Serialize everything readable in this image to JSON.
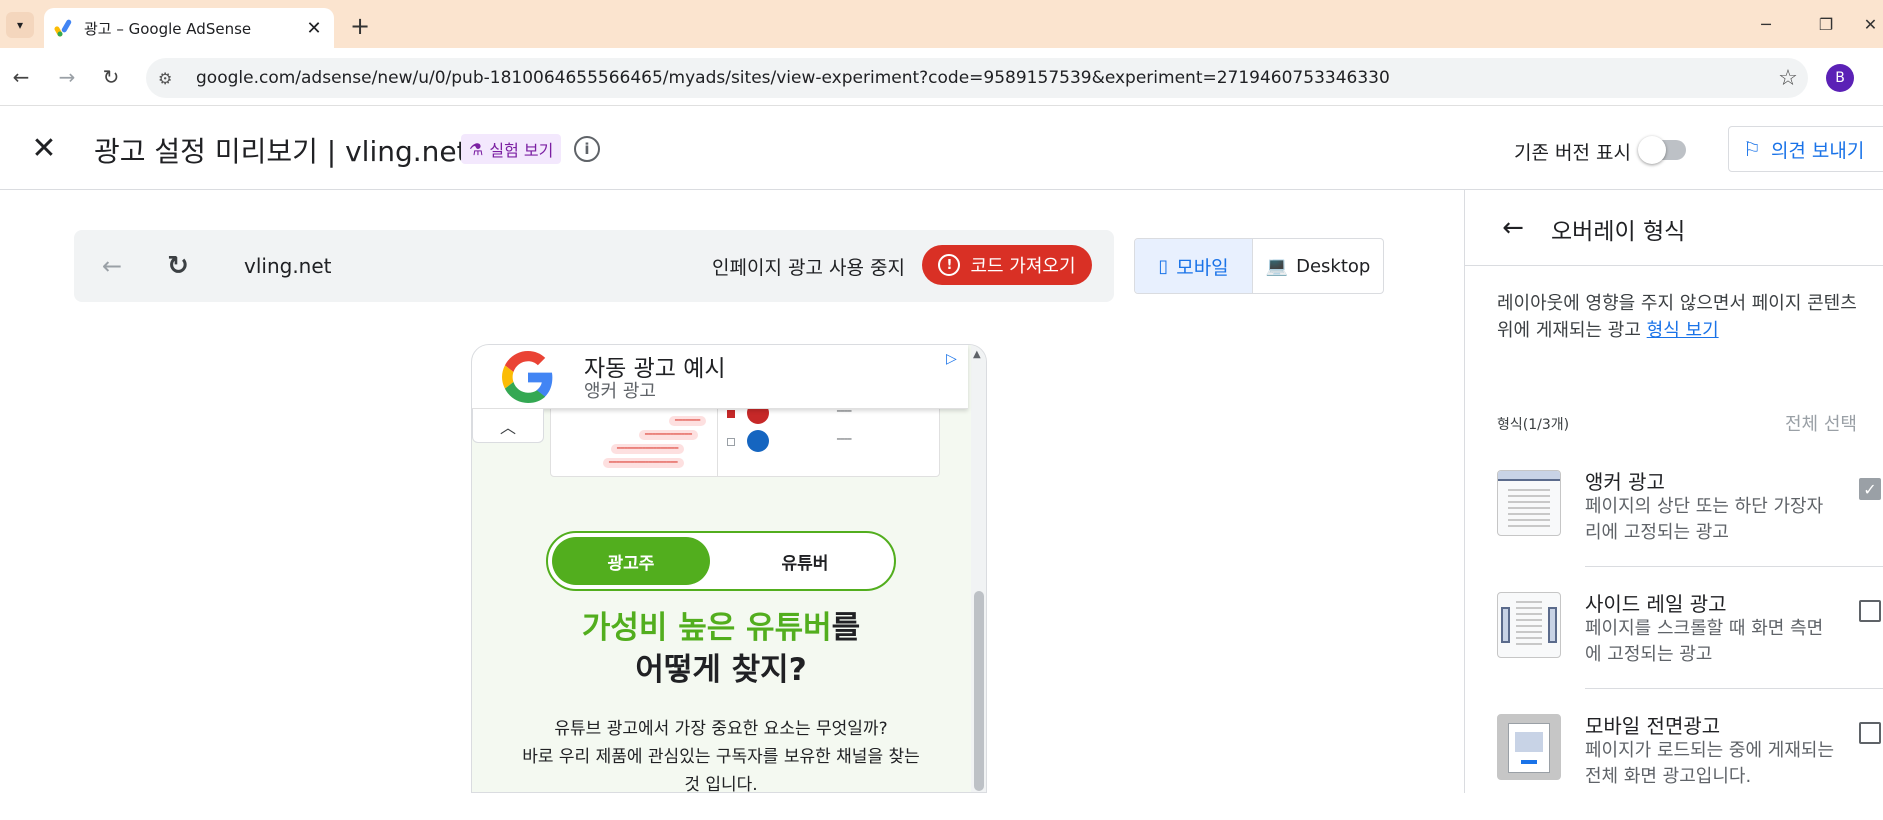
{
  "browser": {
    "tab_title": "광고 – Google AdSense",
    "url": "google.com/adsense/new/u/0/pub-1810064655566465/myads/sites/view-experiment?code=9589157539&experiment=2719460753346330",
    "profile_initial": "B"
  },
  "header": {
    "title": "광고 설정 미리보기 | vling.net",
    "experiment_chip": "실험 보기",
    "legacy_toggle_label": "기존 버전 표시",
    "feedback_button": "의견 보내기"
  },
  "preview_toolbar": {
    "site": "vling.net",
    "stop_label": "인페이지 광고 사용 중지",
    "get_code_button": "코드 가져오기"
  },
  "device_switch": {
    "mobile": "모바일",
    "desktop": "Desktop",
    "selected": "mobile"
  },
  "preview": {
    "ad_title": "자동 광고 예시",
    "ad_subtitle": "앵커 광고",
    "segment_active": "광고주",
    "segment_inactive": "유튜버",
    "headline_green": "가성비 높은 유튜버",
    "headline_rest1": "를",
    "headline_line2": "어떻게 찾지?",
    "body_line1": "유튜브 광고에서 가장 중요한 요소는 무엇일까?",
    "body_line2": "바로 우리 제품에 관심있는 구독자를 보유한 채널을 찾는",
    "body_line3": "것 입니다."
  },
  "right_panel": {
    "title": "오버레이 형식",
    "description": "레이아웃에 영향을 주지 않으면서 페이지 콘텐츠 위에 게재되는 광고",
    "description_link": "형식 보기",
    "count_label": "형식(1/3개)",
    "select_all": "전체 선택",
    "formats": [
      {
        "name": "앵커 광고",
        "desc": "페이지의 상단 또는 하단 가장자리에 고정되는 광고",
        "checked": true
      },
      {
        "name": "사이드 레일 광고",
        "desc": "페이지를 스크롤할 때 화면 측면에 고정되는 광고",
        "checked": false
      },
      {
        "name": "모바일 전면광고",
        "desc": "페이지가 로드되는 중에 게재되는 전체 화면 광고입니다.",
        "checked": false
      }
    ]
  },
  "colors": {
    "accent_blue": "#1a73e8",
    "danger_red": "#d93025",
    "brand_green": "#52ae1e",
    "tab_bar": "#fbe4cf"
  }
}
